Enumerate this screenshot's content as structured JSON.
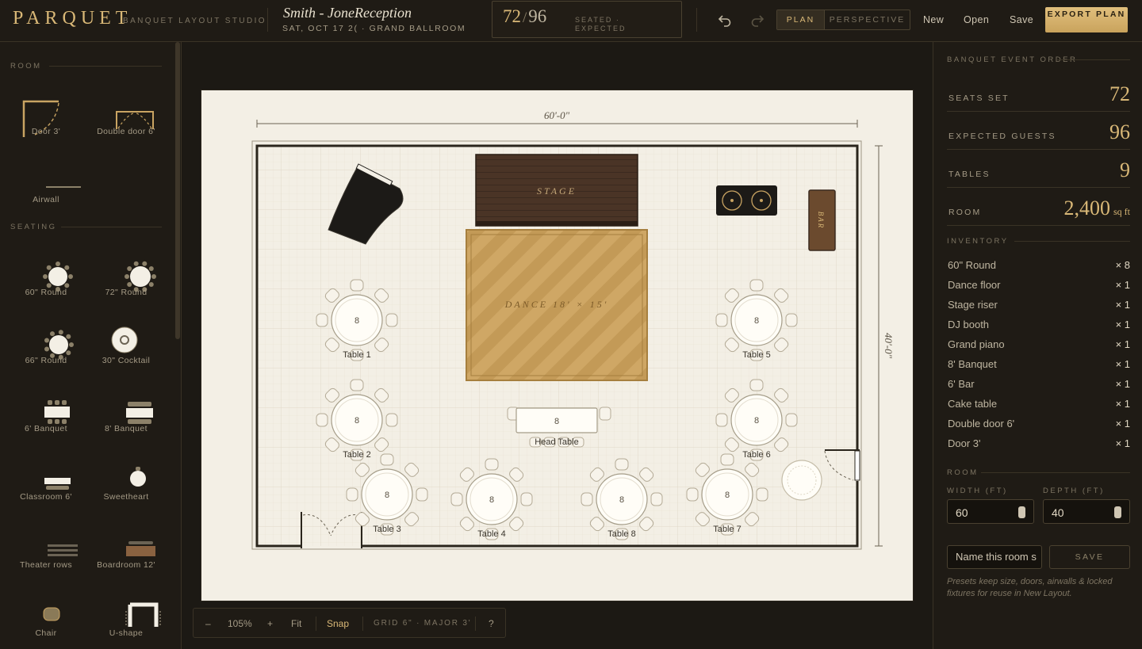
{
  "app": {
    "logo": "PARQUET",
    "subtitle": "BANQUET LAYOUT STUDIO"
  },
  "event": {
    "title": "Smith - JoneReception",
    "meta": "SAT, OCT 17 2( · GRAND BALLROOM"
  },
  "counter": {
    "seated": "72",
    "slash": "/",
    "expected": "96",
    "label": "SEATED · EXPECTED"
  },
  "toolbar": {
    "undo_icon": "undo-icon",
    "redo_icon": "redo-icon",
    "view_plan": "PLAN",
    "view_perspective": "PERSPECTIVE",
    "new": "New",
    "open": "Open",
    "save": "Save",
    "export": "EXPORT PLAN"
  },
  "palette": {
    "room_heading": "ROOM",
    "seating_heading": "SEATING",
    "room_items": [
      {
        "label": "Door 3'",
        "icon": "door-icon"
      },
      {
        "label": "Double door 6'",
        "icon": "double-door-icon"
      },
      {
        "label": "Airwall",
        "icon": "airwall-icon"
      }
    ],
    "seating_items": [
      {
        "label": "60\" Round",
        "icon": "round-table-icon"
      },
      {
        "label": "72\" Round",
        "icon": "round-table-icon"
      },
      {
        "label": "66\" Round",
        "icon": "round-table-icon"
      },
      {
        "label": "30\" Cocktail",
        "icon": "cocktail-table-icon"
      },
      {
        "label": "6' Banquet",
        "icon": "banquet-table-icon"
      },
      {
        "label": "8' Banquet",
        "icon": "banquet-table-icon"
      },
      {
        "label": "Classroom 6'",
        "icon": "classroom-table-icon"
      },
      {
        "label": "Sweetheart",
        "icon": "sweetheart-table-icon"
      },
      {
        "label": "Theater rows",
        "icon": "theater-rows-icon"
      },
      {
        "label": "Boardroom 12'",
        "icon": "boardroom-table-icon"
      },
      {
        "label": "Chair",
        "icon": "chair-icon"
      },
      {
        "label": "U-shape",
        "icon": "u-shape-icon"
      }
    ]
  },
  "plan": {
    "width_label": "60'-0\"",
    "depth_label": "40'-0\"",
    "stage_label": "STAGE",
    "dance_label": "DANCE 18' × 15'",
    "bar_label": "BAR",
    "tables": [
      {
        "name": "Table 1",
        "seats": "8"
      },
      {
        "name": "Table 2",
        "seats": "8"
      },
      {
        "name": "Table 3",
        "seats": "8"
      },
      {
        "name": "Table 4",
        "seats": "8"
      },
      {
        "name": "Table 5",
        "seats": "8"
      },
      {
        "name": "Table 6",
        "seats": "8"
      },
      {
        "name": "Table 7",
        "seats": "8"
      },
      {
        "name": "Table 8",
        "seats": "8"
      }
    ],
    "head_table": {
      "name": "Head Table",
      "seats": "8"
    }
  },
  "zoombar": {
    "minus": "–",
    "zoom": "105%",
    "plus": "+",
    "fit": "Fit",
    "snap": "Snap",
    "grid": "GRID 6\" · MAJOR 3'",
    "help": "?"
  },
  "beo": {
    "heading": "BANQUET EVENT ORDER",
    "stats": [
      {
        "key": "SEATS SET",
        "value": "72"
      },
      {
        "key": "EXPECTED GUESTS",
        "value": "96"
      },
      {
        "key": "TABLES",
        "value": "9"
      },
      {
        "key": "ROOM",
        "value": "2,400",
        "unit": "sq ft"
      }
    ],
    "inventory_heading": "INVENTORY",
    "inventory": [
      {
        "name": "60\" Round",
        "count": "× 8"
      },
      {
        "name": "Dance floor",
        "count": "× 1"
      },
      {
        "name": "Stage riser",
        "count": "× 1"
      },
      {
        "name": "DJ booth",
        "count": "× 1"
      },
      {
        "name": "Grand piano",
        "count": "× 1"
      },
      {
        "name": "8' Banquet",
        "count": "× 1"
      },
      {
        "name": "6' Bar",
        "count": "× 1"
      },
      {
        "name": "Cake table",
        "count": "× 1"
      },
      {
        "name": "Double door 6'",
        "count": "× 1"
      },
      {
        "name": "Door 3'",
        "count": "× 1"
      }
    ],
    "room_heading": "ROOM",
    "width_label": "WIDTH (FT)",
    "width_value": "60",
    "depth_label": "DEPTH (FT)",
    "depth_value": "40",
    "name_placeholder": "Name this room s",
    "save_label": "SAVE",
    "hint": "Presets keep size, doors, airwalls & locked fixtures for reuse in New Layout."
  },
  "colors": {
    "accent": "#d9b877",
    "background": "#1b1812",
    "paper": "#f3efe5",
    "stage": "#4a3426",
    "dance": "#c9a462"
  }
}
